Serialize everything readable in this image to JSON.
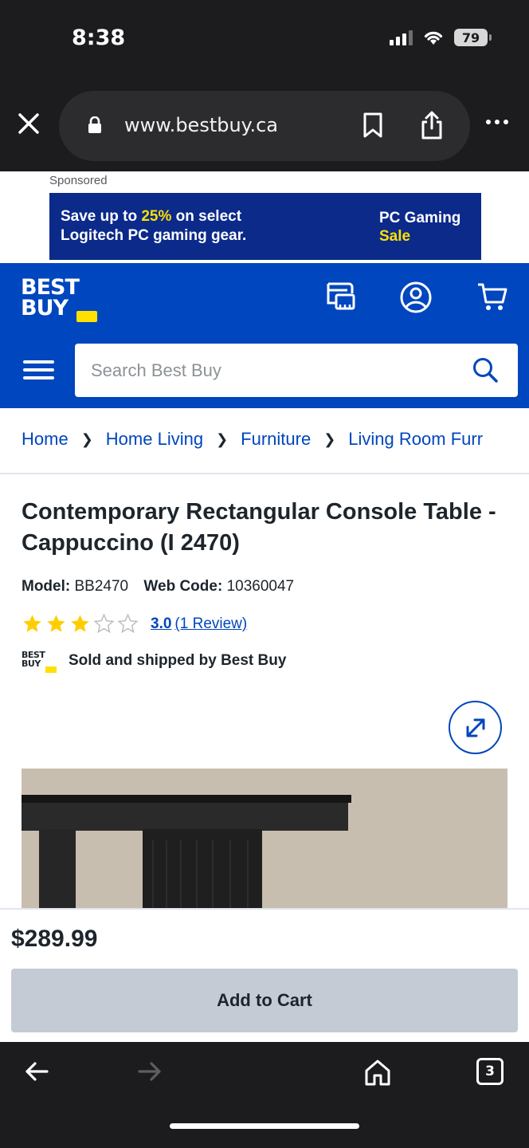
{
  "status_bar": {
    "time": "8:38",
    "battery": "79"
  },
  "browser": {
    "url": "www.bestbuy.ca",
    "tab_count": "3"
  },
  "ad": {
    "sponsored_label": "Sponsored",
    "line1_pre": "Save up to ",
    "line1_highlight": "25%",
    "line1_post": " on select",
    "line2": "Logitech PC gaming gear.",
    "right_line1": "PC Gaming",
    "right_line2": "Sale"
  },
  "header": {
    "logo_line1": "BEST",
    "logo_line2": "BUY"
  },
  "search": {
    "placeholder": "Search Best Buy"
  },
  "breadcrumb": [
    "Home",
    "Home Living",
    "Furniture",
    "Living Room Furr"
  ],
  "product": {
    "title": "Contemporary Rectangular Console Table - Cappuccino (I 2470)",
    "model_label": "Model:",
    "model_value": "BB2470",
    "webcode_label": "Web Code:",
    "webcode_value": "10360047",
    "rating": 3,
    "rating_max": 5,
    "rating_text": "3.0",
    "review_text": "(1 Review)",
    "sold_by": "Sold and shipped by Best Buy",
    "price": "$289.99",
    "add_to_cart": "Add to Cart"
  },
  "colors": {
    "brand_blue": "#0046be",
    "brand_yellow": "#ffe000",
    "star": "#ffce00"
  }
}
